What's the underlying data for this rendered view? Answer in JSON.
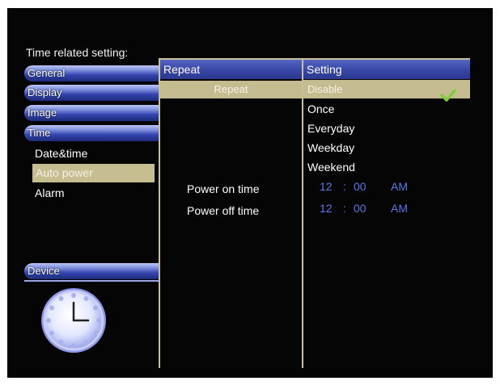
{
  "heading": "Time related setting:",
  "sidebar": {
    "categories": [
      "General",
      "Display",
      "Image",
      "Time"
    ],
    "time_subitems": [
      "Date&time",
      "Auto power",
      "Alarm"
    ],
    "selected_subitem": "Auto power",
    "device_label": "Device"
  },
  "middle": {
    "header": "Repeat",
    "selected_row": "Repeat",
    "power_on_label": "Power on time",
    "power_off_label": "Power off time"
  },
  "right": {
    "header": "Setting",
    "options": [
      "Disable",
      "Once",
      "Everyday",
      "Weekday",
      "Weekend"
    ],
    "selected_option": "Disable",
    "power_on": {
      "hour": "12",
      "sep": ":",
      "minute": "00",
      "ampm": "AM"
    },
    "power_off": {
      "hour": "12",
      "sep": ":",
      "minute": "00",
      "ampm": "AM"
    }
  },
  "colors": {
    "background": "#050505",
    "highlight": "#c4bb90",
    "header_blue": "#3a48a6",
    "time_blue": "#5a78e4",
    "check_green": "#7ccd3e"
  },
  "icons": [
    "clock-icon",
    "checkmark-icon"
  ]
}
